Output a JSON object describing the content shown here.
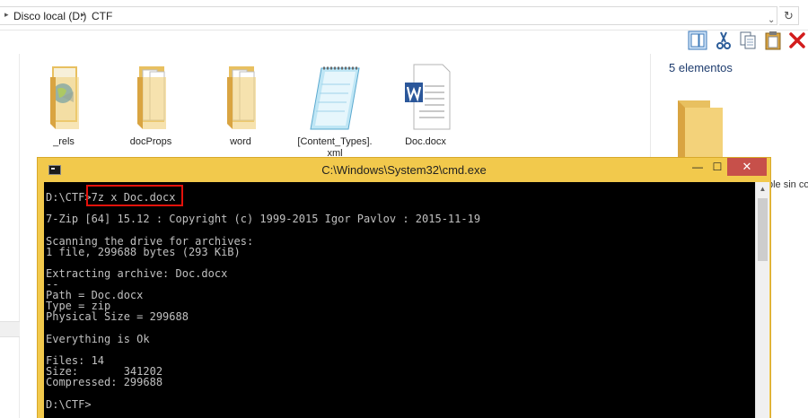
{
  "explorer": {
    "breadcrumb": [
      {
        "label": "Disco local (D:)"
      },
      {
        "label": "CTF"
      }
    ],
    "dropdown_glyph": "⌄",
    "refresh_glyph": "↻",
    "toolbar_icons": [
      "preview-pane-icon",
      "cut-icon",
      "copy-icon",
      "paste-icon",
      "delete-icon"
    ],
    "files": [
      {
        "name": "_rels",
        "icon": "folder-web-icon"
      },
      {
        "name": "docProps",
        "icon": "folder-docs-icon"
      },
      {
        "name": "word",
        "icon": "folder-docs-icon"
      },
      {
        "name": "[Content_Types].\nxml",
        "icon": "notepad-xml-icon"
      },
      {
        "name": "Doc.docx",
        "icon": "word-document-icon"
      }
    ],
    "details": {
      "count": "5 elementos",
      "text": "ble sin co"
    }
  },
  "cmd": {
    "title": "C:\\Windows\\System32\\cmd.exe",
    "minimize_glyph": "—",
    "maximize_glyph": "☐",
    "close_glyph": "✕",
    "lines": [
      "D:\\CTF>7z x Doc.docx",
      "",
      "7-Zip [64] 15.12 : Copyright (c) 1999-2015 Igor Pavlov : 2015-11-19",
      "",
      "Scanning the drive for archives:",
      "1 file, 299688 bytes (293 KiB)",
      "",
      "Extracting archive: Doc.docx",
      "--",
      "Path = Doc.docx",
      "Type = zip",
      "Physical Size = 299688",
      "",
      "Everything is Ok",
      "",
      "Files: 14",
      "Size:       341202",
      "Compressed: 299688",
      "",
      "D:\\CTF>"
    ],
    "highlight_color": "#e3120b"
  }
}
